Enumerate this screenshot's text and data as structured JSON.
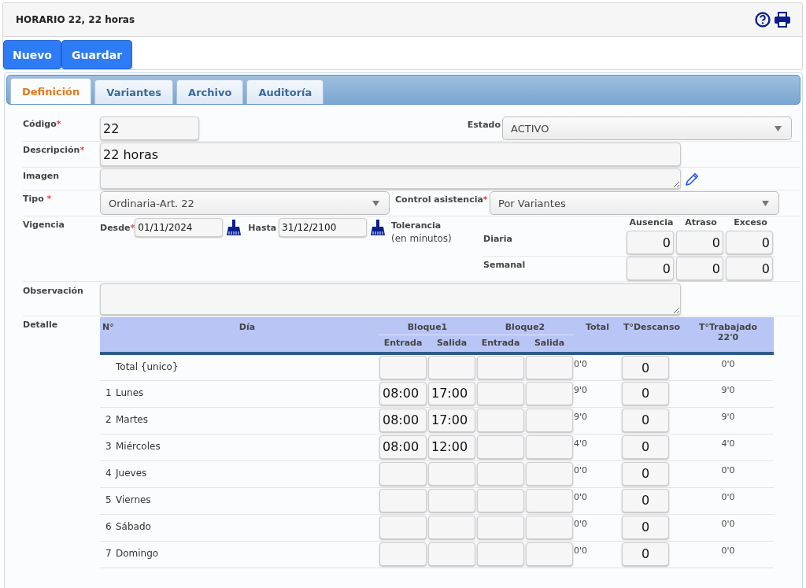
{
  "header": {
    "title": "HORARIO 22, 22 horas"
  },
  "toolbar": {
    "buttons": [
      "Nuevo",
      "Guardar"
    ]
  },
  "tabs": [
    {
      "label": "Definición",
      "selected": true
    },
    {
      "label": "Variantes",
      "selected": false
    },
    {
      "label": "Archivo",
      "selected": false
    },
    {
      "label": "Auditoría",
      "selected": false
    }
  ],
  "form": {
    "codigo": {
      "label": "Código",
      "mark": "*",
      "value": "22"
    },
    "estado": {
      "label": "Estado",
      "value": "ACTIVO"
    },
    "descripcion": {
      "label": "Descripción",
      "mark": "*",
      "value": "22 horas"
    },
    "imagen": {
      "label": "Imagen"
    },
    "tipo": {
      "label": "Tipo",
      "mark": "*",
      "value": "Ordinaria-Art. 22"
    },
    "control": {
      "label": "Control asistencia",
      "mark": "*",
      "value": "Por Variantes"
    },
    "vigencia": {
      "label": "Vigencia",
      "desde": {
        "label": "Desde",
        "mark": "*",
        "value": "01/11/2024"
      },
      "hasta": {
        "label": "Hasta",
        "value": "31/12/2100"
      }
    },
    "tolerancia": {
      "label": "Tolerancia",
      "sublabel": "(en minutos)",
      "columns": [
        "Ausencia",
        "Atraso",
        "Exceso"
      ],
      "rows": [
        {
          "label": "Diaria",
          "values": [
            "0",
            "0",
            "0"
          ]
        },
        {
          "label": "Semanal",
          "values": [
            "0",
            "0",
            "0"
          ]
        }
      ]
    },
    "observacion": {
      "label": "Observación"
    }
  },
  "detalle": {
    "label": "Detalle",
    "headers": {
      "no": "N°",
      "dia": "Día",
      "bloque1": "Bloque1",
      "bloque2": "Bloque2",
      "entrada1": "Entrada",
      "salida1": "Salida",
      "entrada2": "Entrada",
      "salida2": "Salida",
      "total": "Total",
      "descanso": "T°Descanso",
      "trabajado": "T°Trabajado",
      "trabajado_total": "22'0"
    },
    "rows": [
      {
        "day": "Total {unico}",
        "total": "0'0",
        "descanso": "0",
        "trabajado": "0'0"
      },
      {
        "no": "1",
        "day": "Lunes",
        "entrada1": "08:00",
        "salida1": "17:00",
        "total": "9'0",
        "descanso": "0",
        "trabajado": "9'0"
      },
      {
        "no": "2",
        "day": "Martes",
        "entrada1": "08:00",
        "salida1": "17:00",
        "total": "9'0",
        "descanso": "0",
        "trabajado": "9'0"
      },
      {
        "no": "3",
        "day": "Miércoles",
        "entrada1": "08:00",
        "salida1": "12:00",
        "total": "4'0",
        "descanso": "0",
        "trabajado": "4'0"
      },
      {
        "no": "4",
        "day": "Jueves",
        "total": "0'0",
        "descanso": "0",
        "trabajado": "0'0"
      },
      {
        "no": "5",
        "day": "Viernes",
        "total": "0'0",
        "descanso": "0",
        "trabajado": "0'0"
      },
      {
        "no": "6",
        "day": "Sábado",
        "total": "0'0",
        "descanso": "0",
        "trabajado": "0'0"
      },
      {
        "no": "7",
        "day": "Domingo",
        "total": "0'0",
        "descanso": "0",
        "trabajado": "0'0"
      }
    ]
  }
}
